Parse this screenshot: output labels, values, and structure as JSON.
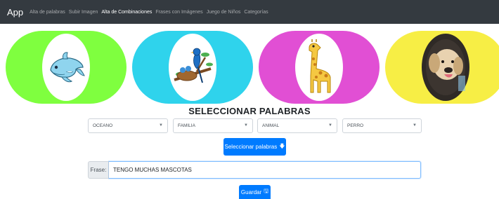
{
  "navbar": {
    "brand": "App",
    "links": [
      {
        "label": "Alta de palabras"
      },
      {
        "label": "Subir Imagen"
      },
      {
        "label": "Alta de Combinaciones"
      },
      {
        "label": "Frases con Imágenes"
      },
      {
        "label": "Juego de Niños"
      },
      {
        "label": "Categorías"
      }
    ],
    "active_link": "Alta de Combinaciones"
  },
  "cards": [
    {
      "color": "#7fff3f",
      "icon": "dolphin-image"
    },
    {
      "color": "#2fd3ec",
      "icon": "birds-nest-image"
    },
    {
      "color": "#e14fd4",
      "icon": "giraffe-image"
    },
    {
      "color": "#f7ee45",
      "icon": "dog-photo-image"
    }
  ],
  "section_title": "SELECCIONAR PALABRAS",
  "selects": [
    {
      "value": "OCEANO"
    },
    {
      "value": "FAMILIA"
    },
    {
      "value": "ANIMAL"
    },
    {
      "value": "PERRO"
    }
  ],
  "select_words_button": {
    "label": "Seleccionar palabras",
    "icon": "arrow-down-icon"
  },
  "frase": {
    "addon_label": "Frase:",
    "value": "TENGO MUCHAS MASCOTAS"
  },
  "save_button": {
    "label": "Guardar",
    "icon": "floppy-disk-icon"
  },
  "colors": {
    "navbar": "#343a40",
    "primary": "#007bff"
  }
}
